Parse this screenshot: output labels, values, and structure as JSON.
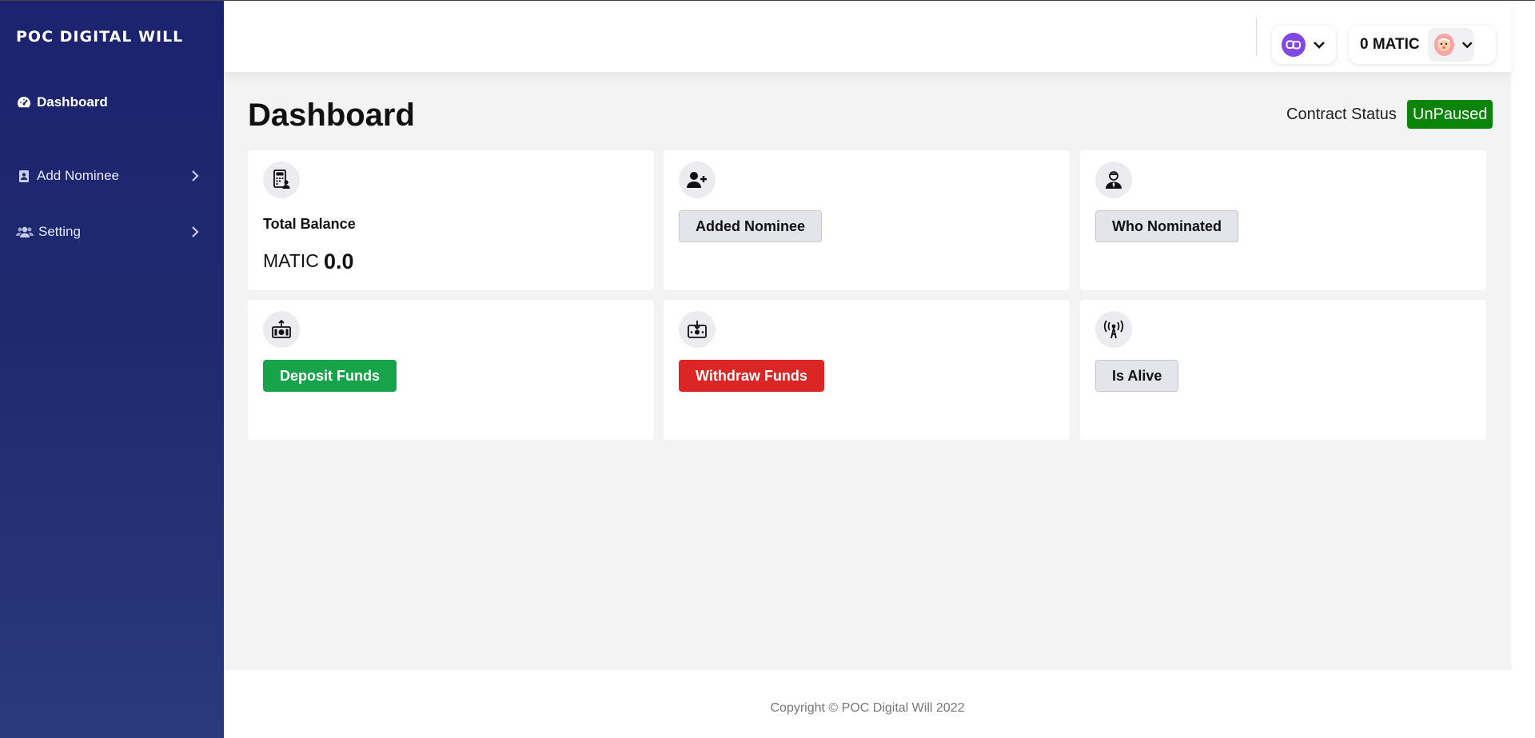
{
  "sidebar": {
    "brand": "POC DIGITAL WILL",
    "items": [
      {
        "label": "Dashboard",
        "icon": "gauge-icon",
        "active": true
      },
      {
        "label": "Add Nominee",
        "icon": "address-book-icon",
        "active": false
      },
      {
        "label": "Setting",
        "icon": "users-icon",
        "active": false
      }
    ]
  },
  "header": {
    "network_icon": "polygon-matic-icon",
    "balance": "0 MATIC",
    "avatar_icon": "account-avatar-icon"
  },
  "main": {
    "title": "Dashboard",
    "contract_status_label": "Contract Status",
    "contract_status": "UnPaused",
    "cards": [
      {
        "icon": "calculator-icon",
        "label": "Total Balance",
        "currency": "MATIC",
        "value": "0.0"
      },
      {
        "icon": "user-plus-icon",
        "button": "Added Nominee"
      },
      {
        "icon": "user-tie-icon",
        "button": "Who Nominated"
      },
      {
        "icon": "money-deposit-icon",
        "button": "Deposit Funds"
      },
      {
        "icon": "money-withdraw-icon",
        "button": "Withdraw Funds"
      },
      {
        "icon": "broadcast-tower-icon",
        "button": "Is Alive"
      }
    ]
  },
  "footer": {
    "copyright": "Copyright © POC Digital Will 2022"
  },
  "colors": {
    "sidebar": "#1c2370",
    "status_green": "#0a850a",
    "deposit_green": "#17a34a",
    "withdraw_red": "#dc2626",
    "matic_purple": "#8247e5"
  }
}
